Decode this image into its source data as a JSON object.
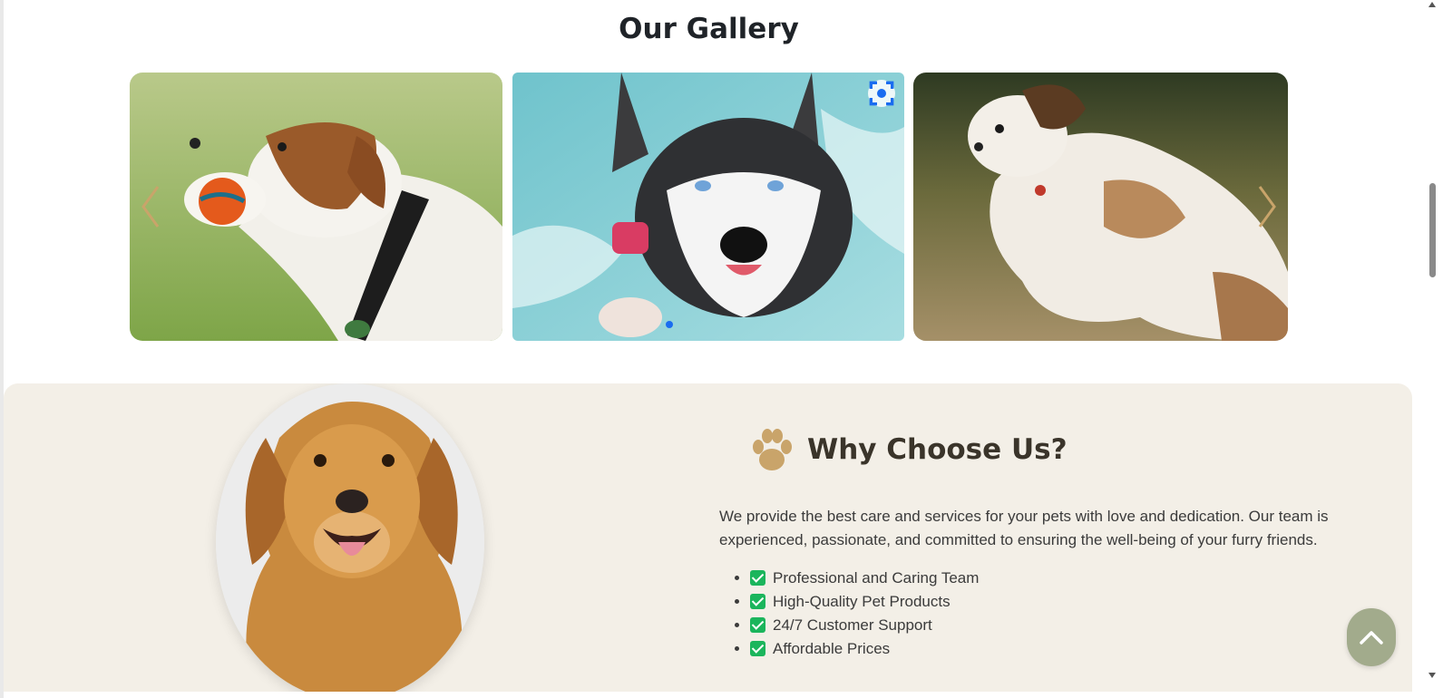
{
  "gallery": {
    "title": "Our Gallery",
    "slides": [
      {
        "subject": "beagle-with-ball-photo"
      },
      {
        "subject": "husky-swimming-photo"
      },
      {
        "subject": "shih-tzu-running-photo"
      }
    ],
    "active_dot": 1
  },
  "why": {
    "title": "Why Choose Us?",
    "description": "We provide the best care and services for your pets with love and dedication. Our team is experienced, passionate, and committed to ensuring the well-being of your furry friends.",
    "features": [
      "Professional and Caring Team",
      "High-Quality Pet Products",
      "24/7 Customer Support",
      "Affordable Prices"
    ]
  },
  "colors": {
    "accent_gold": "#c9a46a",
    "check_green": "#1bb55c",
    "section_bg": "#f3efe7",
    "back_to_top": "#a2ab8c",
    "dot_blue": "#1a6cf0"
  },
  "icons": {
    "heading": "paw-icon",
    "feature": "check-icon",
    "back_to_top": "chevron-up-icon",
    "prev": "chevron-left-icon",
    "next": "chevron-right-icon"
  }
}
